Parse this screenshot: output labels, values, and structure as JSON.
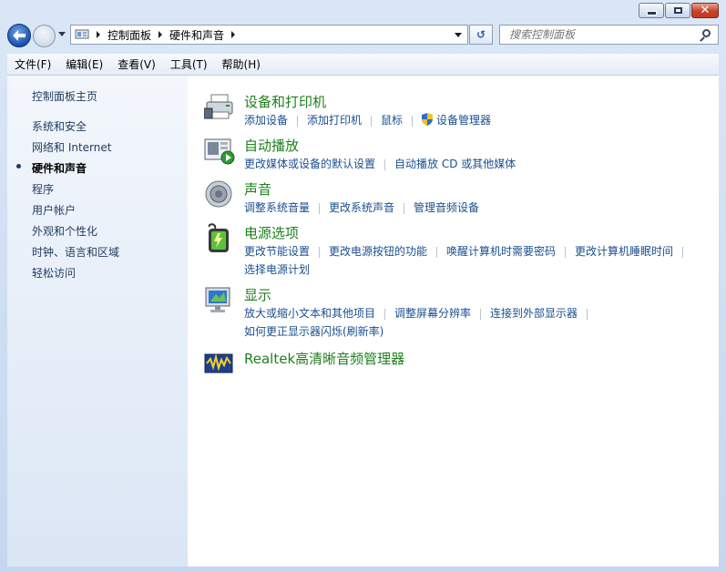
{
  "navbar": {
    "breadcrumb": [
      "控制面板",
      "硬件和声音"
    ],
    "search_placeholder": "搜索控制面板"
  },
  "menu": [
    "文件(F)",
    "编辑(E)",
    "查看(V)",
    "工具(T)",
    "帮助(H)"
  ],
  "sidebar": {
    "items": [
      {
        "label": "控制面板主页"
      },
      {
        "label": "系统和安全"
      },
      {
        "label": "网络和 Internet"
      },
      {
        "label": "硬件和声音"
      },
      {
        "label": "程序"
      },
      {
        "label": "用户帐户"
      },
      {
        "label": "外观和个性化"
      },
      {
        "label": "时钟、语言和区域"
      },
      {
        "label": "轻松访问"
      }
    ]
  },
  "categories": [
    {
      "title": "设备和打印机",
      "icon": "printer-icon",
      "links": [
        "添加设备",
        "添加打印机",
        "鼠标",
        "设备管理器"
      ]
    },
    {
      "title": "自动播放",
      "icon": "autoplay-icon",
      "links": [
        "更改媒体或设备的默认设置",
        "自动播放 CD 或其他媒体"
      ]
    },
    {
      "title": "声音",
      "icon": "speaker-icon",
      "links": [
        "调整系统音量",
        "更改系统声音",
        "管理音频设备"
      ]
    },
    {
      "title": "电源选项",
      "icon": "battery-icon",
      "links": [
        "更改节能设置",
        "更改电源按钮的功能",
        "唤醒计算机时需要密码",
        "更改计算机睡眠时间",
        "选择电源计划"
      ]
    },
    {
      "title": "显示",
      "icon": "monitor-icon",
      "links": [
        "放大或缩小文本和其他项目",
        "调整屏幕分辨率",
        "连接到外部显示器",
        "如何更正显示器闪烁(刷新率)"
      ]
    },
    {
      "title": "Realtek高清晰音频管理器",
      "icon": "realtek-audio-icon",
      "links": []
    }
  ]
}
